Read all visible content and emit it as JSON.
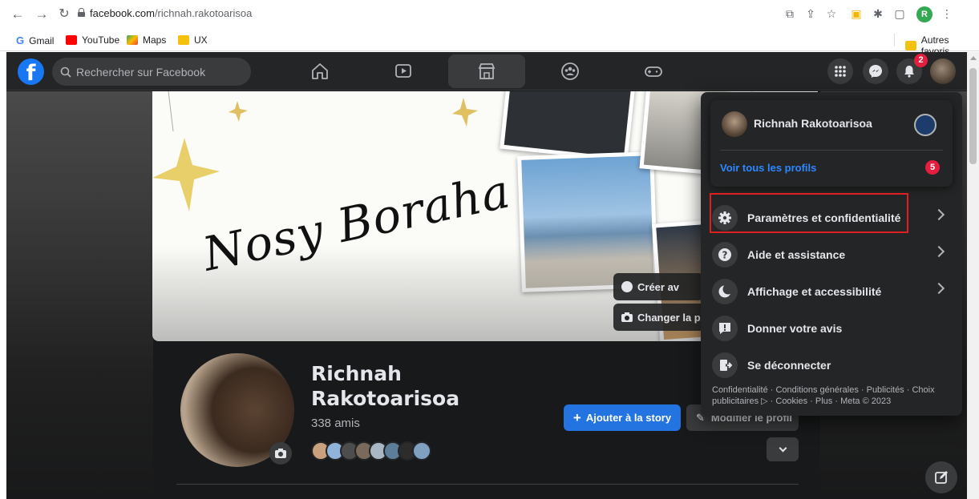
{
  "browser": {
    "url_domain": "facebook.com",
    "url_path": "/richnah.rakotoarisoa",
    "profile_initial": "R",
    "bookmarks": [
      {
        "label": "Gmail",
        "color": "#ea4335"
      },
      {
        "label": "YouTube",
        "color": "#ff0000"
      },
      {
        "label": "Maps",
        "color": "#34a853"
      },
      {
        "label": "UX",
        "color": "#f4c20d"
      }
    ],
    "other_bookmarks": "Autres favoris"
  },
  "fb": {
    "search_placeholder": "Rechercher sur Facebook",
    "notifications_count": "2",
    "nav_tabs": [
      "home-icon",
      "watch-icon",
      "marketplace-icon",
      "groups-icon",
      "gaming-icon"
    ],
    "active_tab": "marketplace-icon",
    "accent": "#2374e1"
  },
  "cover": {
    "script_text": "Nosy Boraha",
    "create_button": "Créer av",
    "change_button": "Changer la pl"
  },
  "profile": {
    "name": "Richnah Rakotoarisoa",
    "friends": "338 amis",
    "add_story": "Ajouter à la story",
    "edit_profile": "Modifier le profil"
  },
  "menu": {
    "user_name": "Richnah Rakotoarisoa",
    "see_all_profiles": "Voir tous les profils",
    "profiles_count": "5",
    "items": [
      {
        "label": "Paramètres et confidentialité",
        "icon": "gear-icon",
        "chevron": true
      },
      {
        "label": "Aide et assistance",
        "icon": "help-icon",
        "chevron": true
      },
      {
        "label": "Affichage et accessibilité",
        "icon": "moon-icon",
        "chevron": true
      },
      {
        "label": "Donner votre avis",
        "icon": "feedback-icon",
        "chevron": false
      },
      {
        "label": "Se déconnecter",
        "icon": "logout-icon",
        "chevron": false
      }
    ],
    "footer": "Confidentialité · Conditions générales · Publicités · Choix publicitaires ▷ · Cookies · Plus · Meta © 2023"
  }
}
